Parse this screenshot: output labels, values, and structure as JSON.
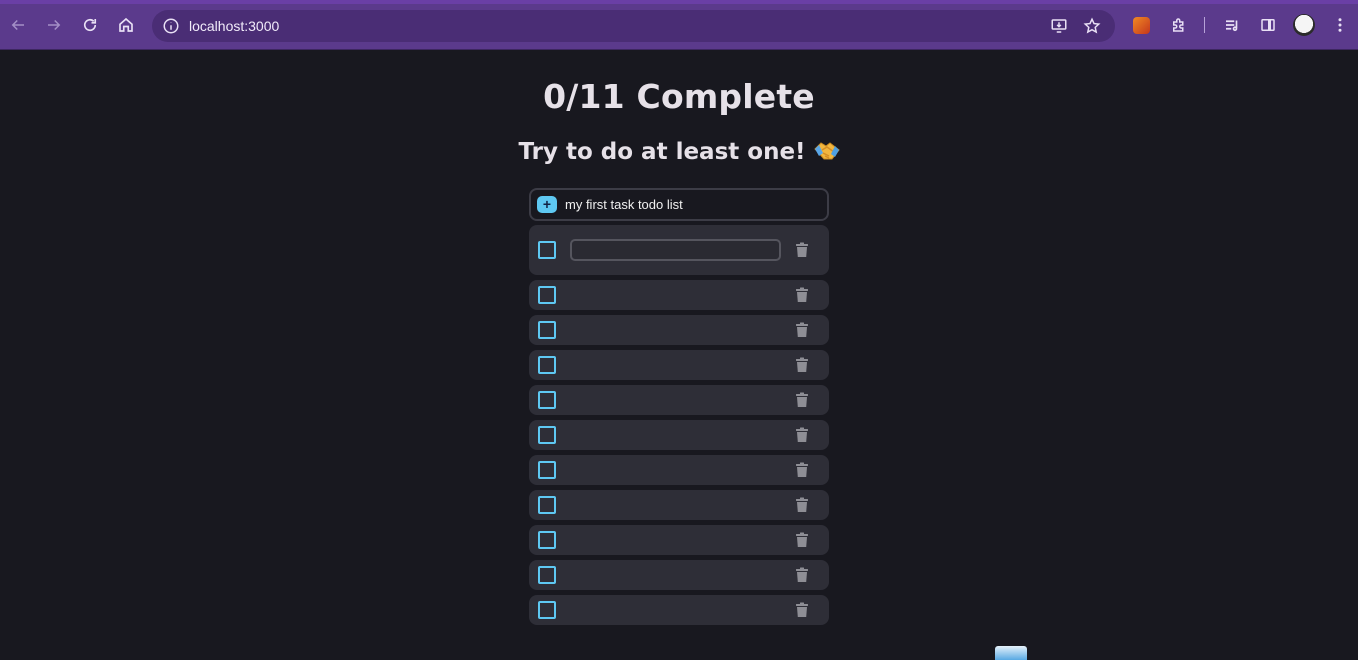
{
  "browser": {
    "url": "localhost:3000",
    "icons": {
      "back": "arrow-left-icon",
      "forward": "arrow-right-icon",
      "reload": "reload-icon",
      "home": "home-icon",
      "site_info": "info-icon",
      "install": "install-app-icon",
      "bookmark": "star-icon",
      "extension": "puzzle-icon",
      "media": "media-queue-icon",
      "sidepanel": "side-panel-icon",
      "menu": "kebab-menu-icon"
    },
    "colors": {
      "frame": "#5b3a8c",
      "omnibox": "#4a2d75"
    }
  },
  "app": {
    "title": "0/11 Complete",
    "subtitle": "Try to do at least one!",
    "subtitle_emoji": "handshake",
    "add": {
      "button_label": "+",
      "input_value": "my first task todo list"
    },
    "todos": [
      {
        "text": "",
        "done": false,
        "editing": true
      },
      {
        "text": "",
        "done": false,
        "editing": false
      },
      {
        "text": "",
        "done": false,
        "editing": false
      },
      {
        "text": "",
        "done": false,
        "editing": false
      },
      {
        "text": "",
        "done": false,
        "editing": false
      },
      {
        "text": "",
        "done": false,
        "editing": false
      },
      {
        "text": "",
        "done": false,
        "editing": false
      },
      {
        "text": "",
        "done": false,
        "editing": false
      },
      {
        "text": "",
        "done": false,
        "editing": false
      },
      {
        "text": "",
        "done": false,
        "editing": false
      },
      {
        "text": "",
        "done": false,
        "editing": false
      }
    ],
    "colors": {
      "background": "#18181f",
      "item": "#2e2e37",
      "accent": "#5ec8f2",
      "text": "#e6e1e8",
      "trash": "#8e8e95"
    }
  }
}
